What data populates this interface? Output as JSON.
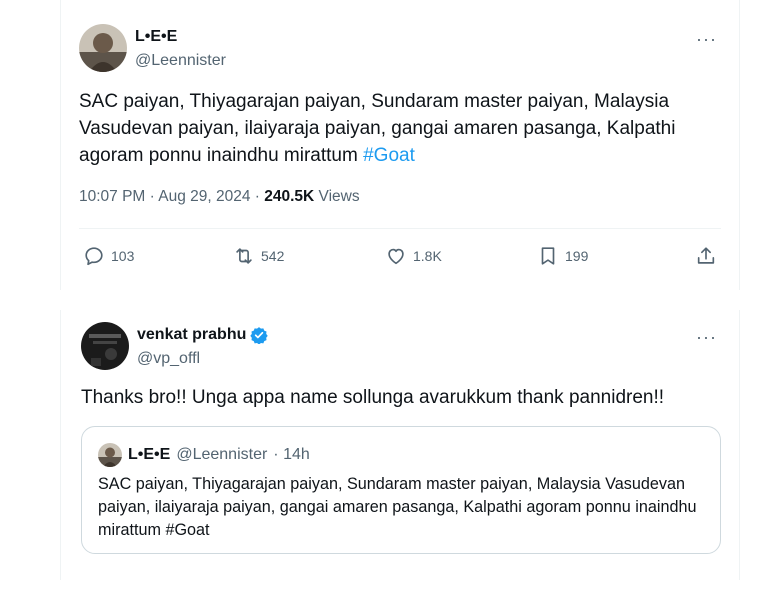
{
  "tweet": {
    "author_name": "L•E•E",
    "author_handle": "@Leennister",
    "text_main": "SAC paiyan, Thiyagarajan paiyan, Sundaram master paiyan, Malaysia Vasudevan paiyan, ilaiyaraja paiyan, gangai amaren pasanga, Kalpathi agoram ponnu inaindhu mirattum ",
    "hashtag": "#Goat",
    "timestamp": "10:07 PM · Aug 29, 2024 · ",
    "views_count": "240.5K",
    "views_label": " Views",
    "more_label": "···",
    "actions": {
      "replies": "103",
      "retweets": "542",
      "likes": "1.8K",
      "bookmarks": "199"
    }
  },
  "reply": {
    "author_name": "venkat prabhu",
    "author_handle": "@vp_offl",
    "verified": true,
    "text": "Thanks bro!! Unga appa name sollunga avarukkum thank pannidren!!",
    "more_label": "···",
    "quote": {
      "author_name": "L•E•E",
      "author_handle": "@Leennister",
      "time": "· 14h",
      "text": "SAC paiyan, Thiyagarajan paiyan, Sundaram master paiyan, Malaysia Vasudevan paiyan, ilaiyaraja paiyan, gangai amaren pasanga, Kalpathi agoram ponnu inaindhu mirattum #Goat"
    }
  },
  "colors": {
    "link": "#1d9bf0",
    "secondary_text": "#536471",
    "verified": "#1d9bf0"
  }
}
